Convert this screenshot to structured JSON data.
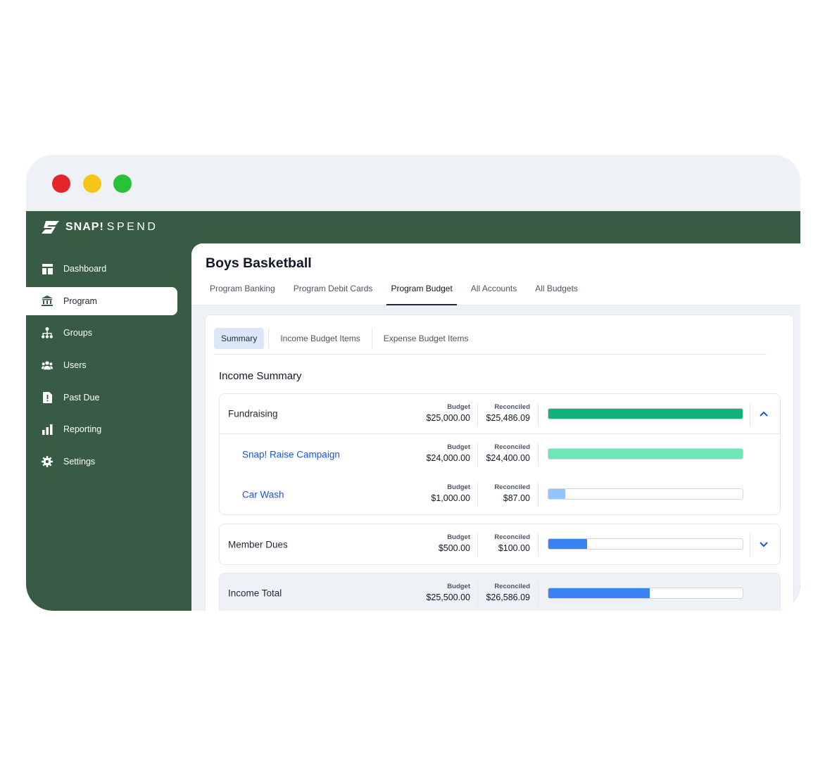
{
  "app": {
    "logo_bold": "SNAP!",
    "logo_light": "SPEND"
  },
  "sidebar": {
    "items": [
      {
        "label": "Dashboard",
        "icon": "dashboard-icon"
      },
      {
        "label": "Program",
        "icon": "bank-icon",
        "active": true
      },
      {
        "label": "Groups",
        "icon": "org-chart-icon"
      },
      {
        "label": "Users",
        "icon": "users-icon"
      },
      {
        "label": "Past Due",
        "icon": "alert-document-icon"
      },
      {
        "label": "Reporting",
        "icon": "bar-chart-icon"
      },
      {
        "label": "Settings",
        "icon": "gear-icon"
      }
    ]
  },
  "header": {
    "title": "Boys Basketball",
    "tabs": [
      "Program Banking",
      "Program Debit Cards",
      "Program Budget",
      "All Accounts",
      "All Budgets"
    ],
    "active_tab": "Program Budget"
  },
  "subtabs": [
    "Summary",
    "Income Budget Items",
    "Expense Budget Items"
  ],
  "active_subtab": "Summary",
  "income_summary": {
    "title": "Income Summary",
    "budget_label": "Budget",
    "reconciled_label": "Reconciled",
    "fundraising": {
      "label": "Fundraising",
      "budget": "$25,000.00",
      "reconciled": "$25,486.09",
      "progress": 1.0,
      "items": [
        {
          "label": "Snap! Raise Campaign",
          "budget": "$24,000.00",
          "reconciled": "$24,400.00",
          "progress": 1.0
        },
        {
          "label": "Car Wash",
          "budget": "$1,000.00",
          "reconciled": "$87.00",
          "progress": 0.087
        }
      ]
    },
    "member_dues": {
      "label": "Member Dues",
      "budget": "$500.00",
      "reconciled": "$100.00",
      "progress": 0.2
    },
    "total": {
      "label": "Income Total",
      "budget": "$25,500.00",
      "reconciled": "$26,586.09",
      "progress": 0.52
    }
  },
  "colors": {
    "sidebar_bg": "#385b44",
    "bar_green": "#13b27a",
    "bar_light_green": "#6ee7b7",
    "bar_light_blue": "#93c5fd",
    "bar_blue": "#3b82f6",
    "link_blue": "#1a56db"
  }
}
